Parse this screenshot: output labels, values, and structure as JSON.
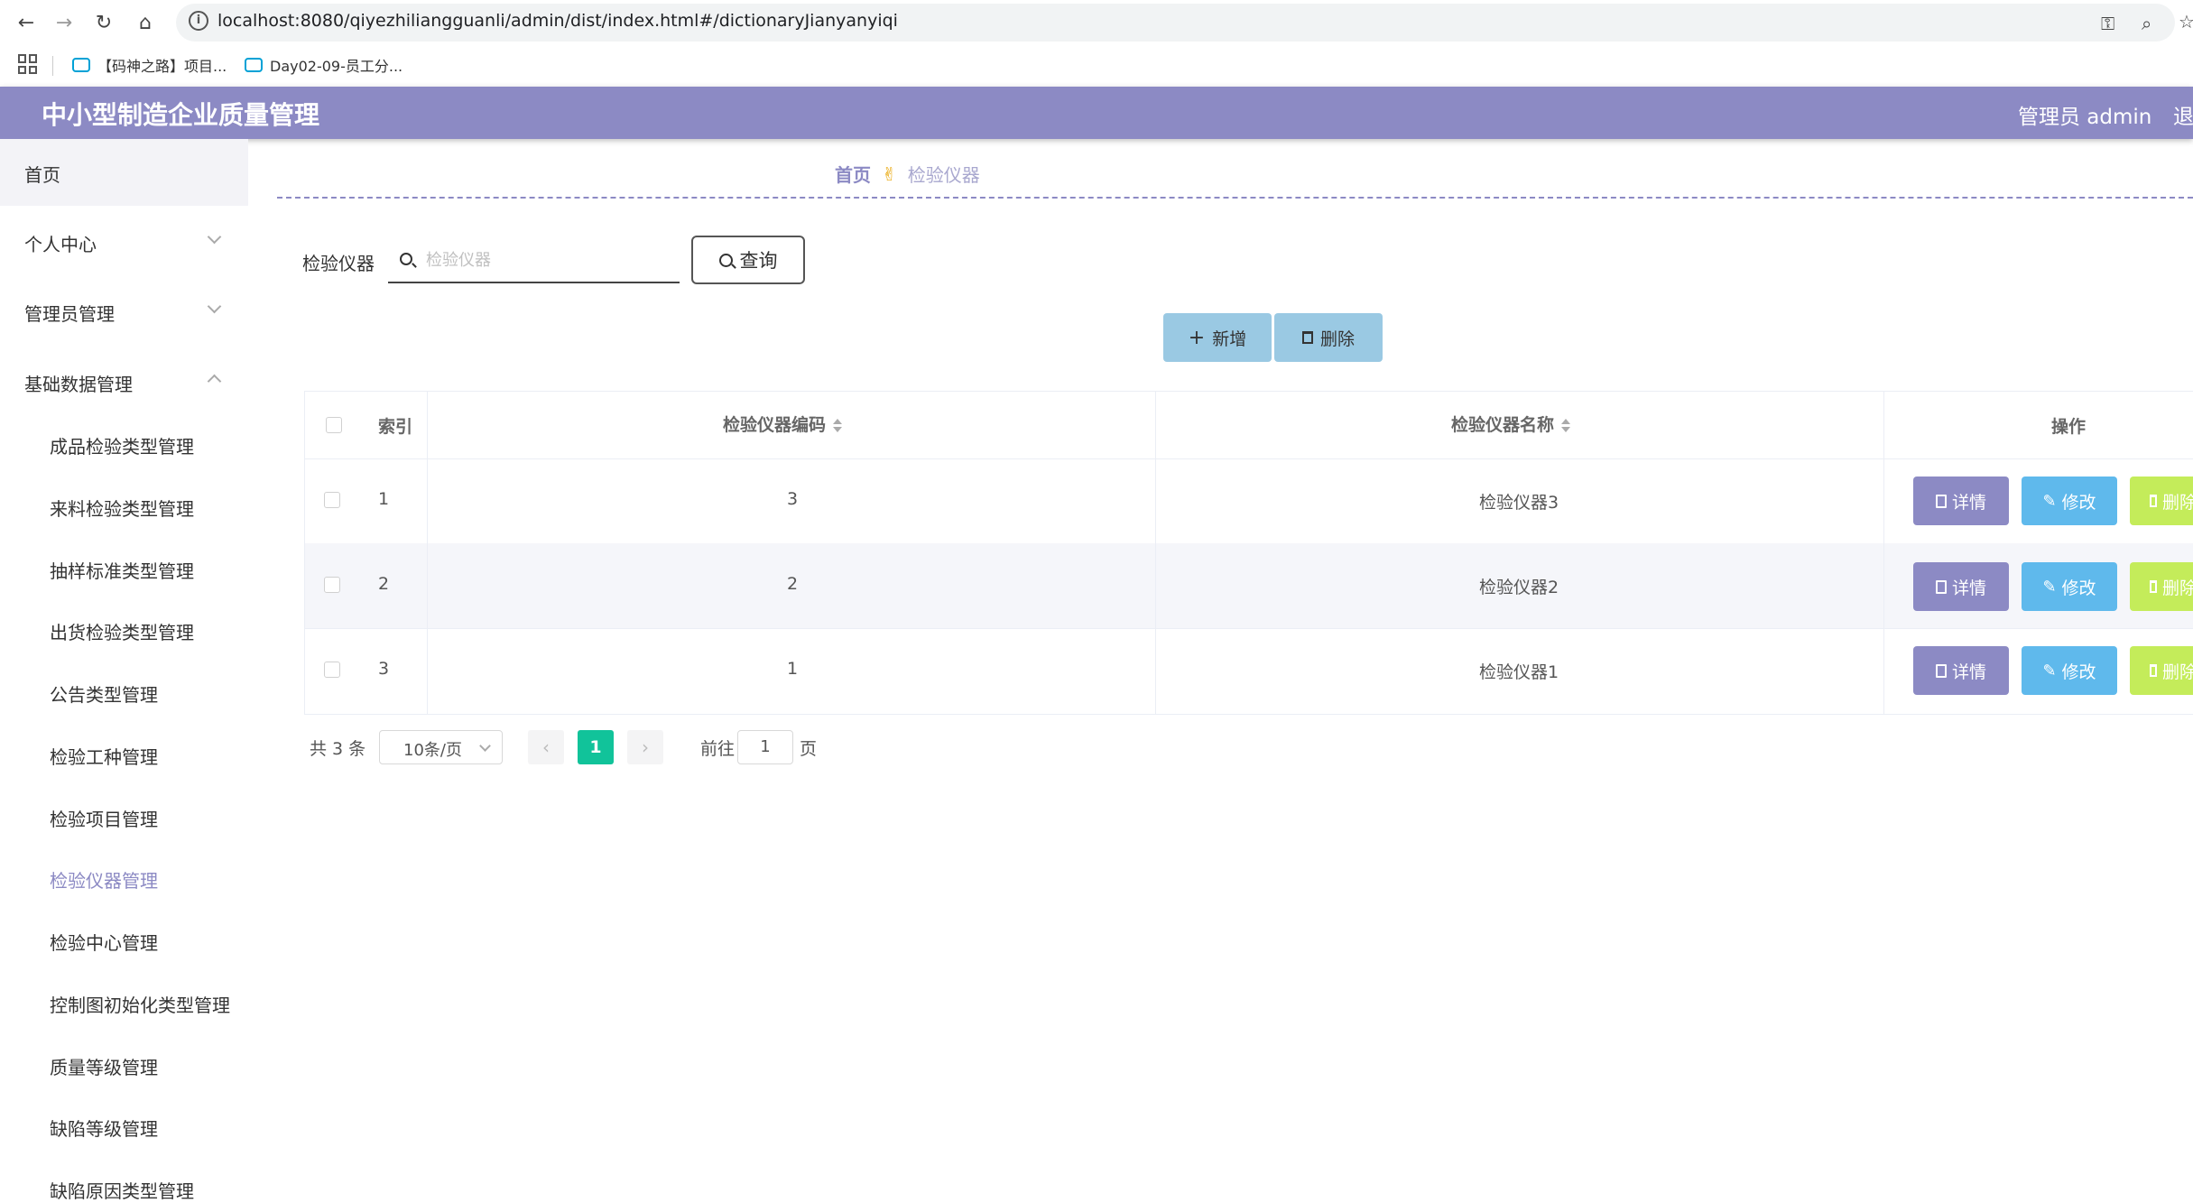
{
  "browser": {
    "url": "localhost:8080/qiyezhiliangguanli/admin/dist/index.html#/dictionaryJianyanyiqi",
    "bookmarks": [
      "【码神之路】项目...",
      "Day02-09-员工分..."
    ]
  },
  "header": {
    "title": "中小型制造企业质量管理",
    "user": "管理员 admin",
    "logout": "退"
  },
  "sidebar": {
    "home": "首页",
    "menus": [
      "个人中心",
      "管理员管理",
      "基础数据管理"
    ],
    "submenus": [
      "成品检验类型管理",
      "来料检验类型管理",
      "抽样标准类型管理",
      "出货检验类型管理",
      "公告类型管理",
      "检验工种管理",
      "检验项目管理",
      "检验仪器管理",
      "检验中心管理",
      "控制图初始化类型管理",
      "质量等级管理",
      "缺陷等级管理",
      "缺陷原因类型管理"
    ],
    "active": "检验仪器管理"
  },
  "breadcrumb": {
    "home": "首页",
    "current": "检验仪器"
  },
  "search": {
    "label": "检验仪器",
    "placeholder": "检验仪器",
    "value": "",
    "button": "查询"
  },
  "actions": {
    "add": "新增",
    "delete": "删除"
  },
  "table": {
    "headers": [
      "索引",
      "检验仪器编码",
      "检验仪器名称",
      "操作"
    ],
    "rows": [
      {
        "index": "1",
        "code": "3",
        "name": "检验仪器3"
      },
      {
        "index": "2",
        "code": "2",
        "name": "检验仪器2"
      },
      {
        "index": "3",
        "code": "1",
        "name": "检验仪器1"
      }
    ],
    "ops": {
      "detail": "详情",
      "edit": "修改",
      "delete": "删除"
    }
  },
  "pagination": {
    "total": "共 3 条",
    "page_size": "10条/页",
    "current": "1",
    "goto_label": "前往",
    "goto_value": "1",
    "page_unit": "页"
  }
}
